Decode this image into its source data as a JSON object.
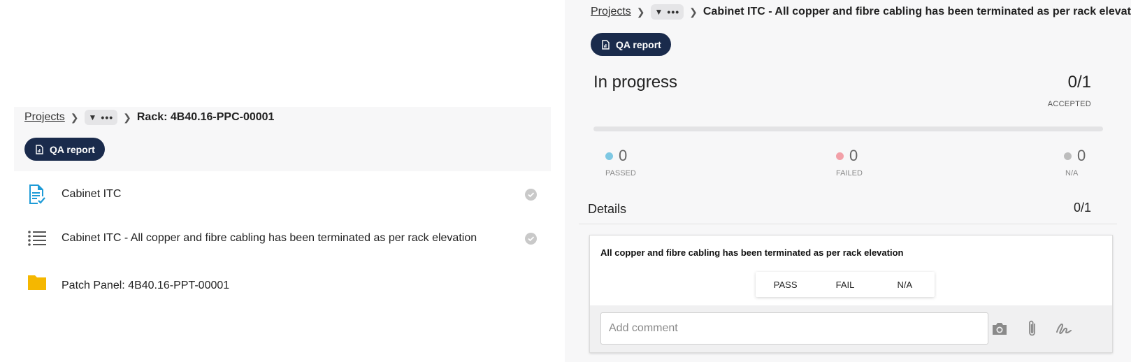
{
  "left_panel": {
    "breadcrumb": {
      "root": "Projects",
      "more": "•••",
      "current": "Rack: 4B40.16-PPC-00001"
    },
    "qa_button": "QA report",
    "items": [
      {
        "label": "Cabinet ITC",
        "icon": "document-check-icon",
        "checked": true
      },
      {
        "label": "Cabinet ITC - All copper and fibre cabling has been terminated as per rack elevation",
        "icon": "list-icon",
        "checked": true
      },
      {
        "label": "Patch Panel: 4B40.16-PPT-00001",
        "icon": "folder-icon",
        "checked": false
      }
    ]
  },
  "right_panel": {
    "breadcrumb": {
      "root": "Projects",
      "more": "•••",
      "current": "Cabinet ITC - All copper and fibre cabling has been terminated as per rack elevation"
    },
    "qa_button": "QA report",
    "status": {
      "title": "In progress",
      "count": "0/1",
      "count_label": "ACCEPTED",
      "progress": 0
    },
    "stats": [
      {
        "value": "0",
        "label": "PASSED",
        "color": "#7ec8e3"
      },
      {
        "value": "0",
        "label": "FAILED",
        "color": "#f2a0a8"
      },
      {
        "value": "0",
        "label": "N/A",
        "color": "#bdbdbd"
      }
    ],
    "details": {
      "title": "Details",
      "count": "0/1"
    },
    "check_item": {
      "title": "All copper and fibre cabling has been terminated as per rack elevation",
      "options": [
        "PASS",
        "FAIL",
        "N/A"
      ],
      "comment_placeholder": "Add comment",
      "comment_value": ""
    }
  },
  "colors": {
    "brand_navy": "#1a2b4c",
    "accent_blue": "#1e9bd7",
    "folder_yellow": "#f5b700"
  }
}
